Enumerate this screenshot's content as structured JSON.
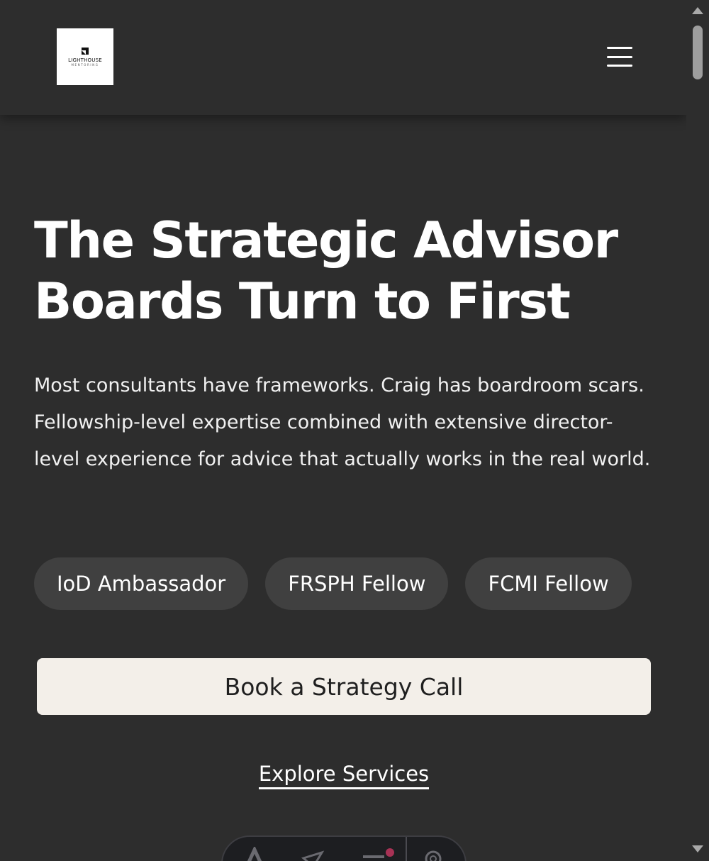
{
  "header": {
    "logo": {
      "wordmark": "LIGHTHOUSE",
      "subtext": "MENTORING"
    },
    "menu_icon": "hamburger-icon"
  },
  "hero": {
    "title_line1": "The Strategic Advisor",
    "title_line2": "Boards Turn to First",
    "description": "Most consultants have frameworks. Craig has boardroom scars. Fellowship-level expertise combined with extensive director-level experience for advice that actually works in the real world.",
    "badges": [
      "IoD Ambassador",
      "FRSPH Fellow",
      "FCMI Fellow"
    ],
    "primary_cta": "Book a Strategy Call",
    "secondary_cta": "Explore Services"
  },
  "toolbar": {
    "icons": [
      "text-icon",
      "send-icon",
      "list-icon",
      "settings-icon"
    ]
  },
  "colors": {
    "background": "#2d2d2d",
    "badge": "#404040",
    "primary_button": "#f3efe9",
    "notification_dot": "#a83255"
  }
}
